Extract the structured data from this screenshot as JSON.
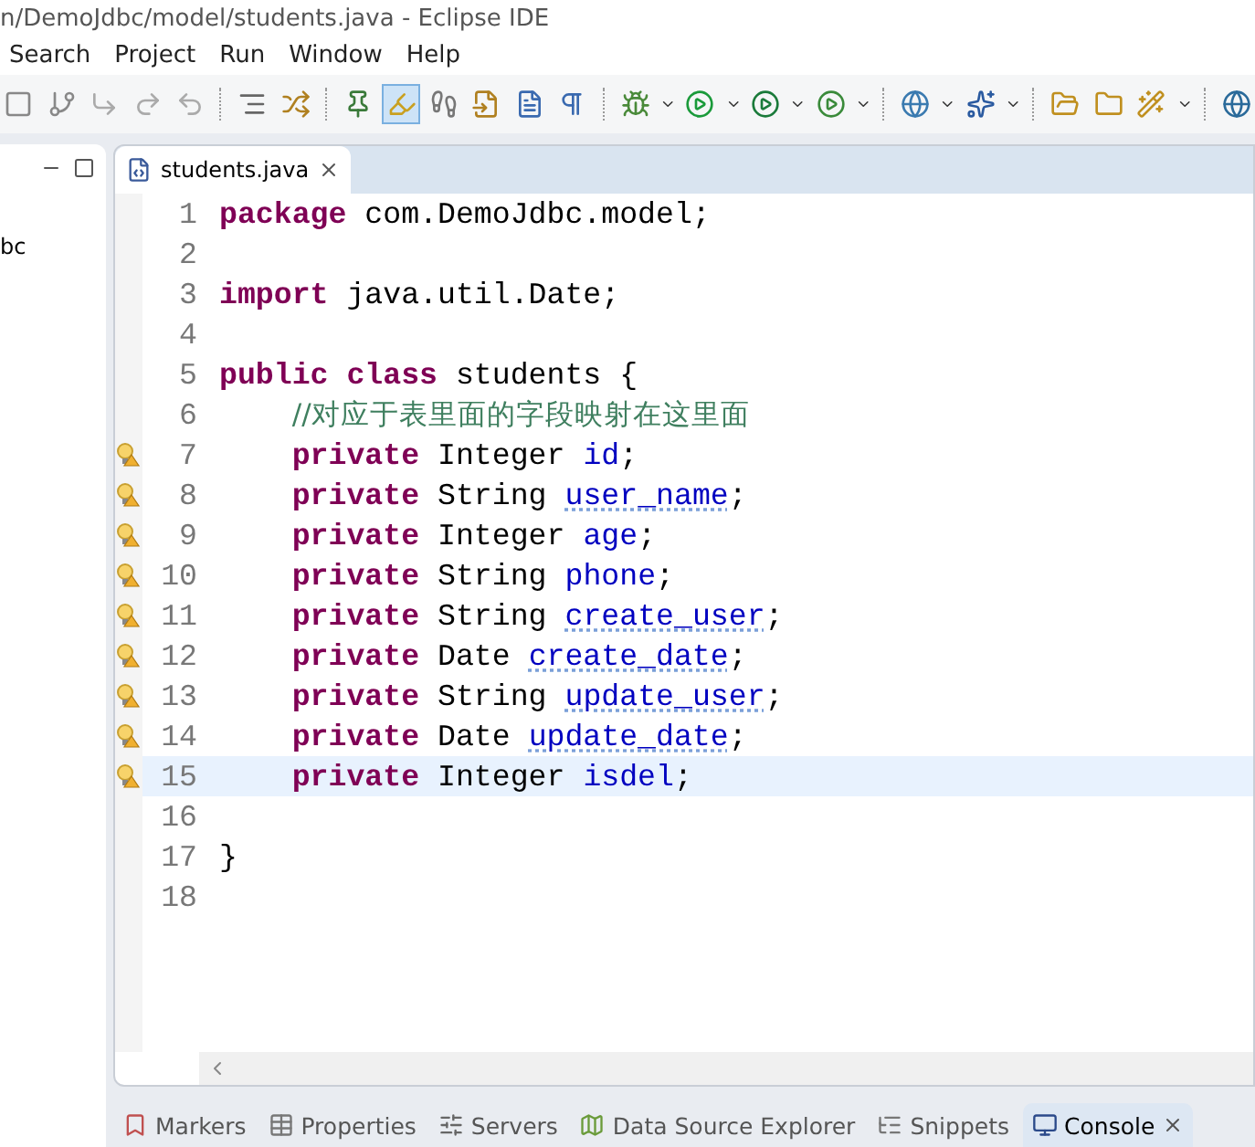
{
  "window": {
    "title": "n/DemoJdbc/model/students.java - Eclipse IDE"
  },
  "menu": [
    "Search",
    "Project",
    "Run",
    "Window",
    "Help"
  ],
  "toolbar": {
    "highlight_toggle": {
      "selected": true
    }
  },
  "left_panel": {
    "items": [
      "bc"
    ]
  },
  "editor": {
    "tab": {
      "label": "students.java",
      "selected": true
    },
    "lines": [
      {
        "number": "1",
        "warning": false,
        "selected": false,
        "tokens": [
          {
            "kind": "keyword",
            "text": "package"
          },
          {
            "kind": "plain",
            "text": " com.DemoJdbc.model;"
          }
        ]
      },
      {
        "number": "2",
        "warning": false,
        "selected": false
      },
      {
        "number": "3",
        "warning": false,
        "selected": false,
        "tokens": [
          {
            "kind": "keyword",
            "text": "import"
          },
          {
            "kind": "plain",
            "text": " java.util.Date;"
          }
        ]
      },
      {
        "number": "4",
        "warning": false,
        "selected": false
      },
      {
        "number": "5",
        "warning": false,
        "selected": false,
        "tokens": [
          {
            "kind": "keyword",
            "text": "public class"
          },
          {
            "kind": "plain",
            "text": " students {"
          }
        ]
      },
      {
        "number": "6",
        "warning": false,
        "selected": false,
        "tokens": [
          {
            "kind": "indent"
          },
          {
            "kind": "comment",
            "text": "//对应于表里面的字段映射在这里面"
          }
        ]
      },
      {
        "number": "7",
        "warning": true,
        "selected": false,
        "tokens": [
          {
            "kind": "indent"
          },
          {
            "kind": "keyword",
            "text": "private"
          },
          {
            "kind": "plain",
            "text": " Integer "
          },
          {
            "kind": "field",
            "text": "id"
          },
          {
            "kind": "plain",
            "text": ";"
          }
        ]
      },
      {
        "number": "8",
        "warning": true,
        "selected": false,
        "tokens": [
          {
            "kind": "indent"
          },
          {
            "kind": "keyword",
            "text": "private"
          },
          {
            "kind": "plain",
            "text": " String "
          },
          {
            "kind": "flagged",
            "text": "user_name"
          },
          {
            "kind": "plain",
            "text": ";"
          }
        ]
      },
      {
        "number": "9",
        "warning": true,
        "selected": false,
        "tokens": [
          {
            "kind": "indent"
          },
          {
            "kind": "keyword",
            "text": "private"
          },
          {
            "kind": "plain",
            "text": " Integer "
          },
          {
            "kind": "field",
            "text": "age"
          },
          {
            "kind": "plain",
            "text": ";"
          }
        ]
      },
      {
        "number": "10",
        "warning": true,
        "selected": false,
        "tokens": [
          {
            "kind": "indent"
          },
          {
            "kind": "keyword",
            "text": "private"
          },
          {
            "kind": "plain",
            "text": " String "
          },
          {
            "kind": "field",
            "text": "phone"
          },
          {
            "kind": "plain",
            "text": ";"
          }
        ]
      },
      {
        "number": "11",
        "warning": true,
        "selected": false,
        "tokens": [
          {
            "kind": "indent"
          },
          {
            "kind": "keyword",
            "text": "private"
          },
          {
            "kind": "plain",
            "text": " String "
          },
          {
            "kind": "flagged",
            "text": "create_user"
          },
          {
            "kind": "plain",
            "text": ";"
          }
        ]
      },
      {
        "number": "12",
        "warning": true,
        "selected": false,
        "tokens": [
          {
            "kind": "indent"
          },
          {
            "kind": "keyword",
            "text": "private"
          },
          {
            "kind": "plain",
            "text": " Date "
          },
          {
            "kind": "flagged",
            "text": "create_date"
          },
          {
            "kind": "plain",
            "text": ";"
          }
        ]
      },
      {
        "number": "13",
        "warning": true,
        "selected": false,
        "tokens": [
          {
            "kind": "indent"
          },
          {
            "kind": "keyword",
            "text": "private"
          },
          {
            "kind": "plain",
            "text": " String "
          },
          {
            "kind": "flagged",
            "text": "update_user"
          },
          {
            "kind": "plain",
            "text": ";"
          }
        ]
      },
      {
        "number": "14",
        "warning": true,
        "selected": false,
        "tokens": [
          {
            "kind": "indent"
          },
          {
            "kind": "keyword",
            "text": "private"
          },
          {
            "kind": "plain",
            "text": " Date "
          },
          {
            "kind": "flagged",
            "text": "update_date"
          },
          {
            "kind": "plain",
            "text": ";"
          }
        ]
      },
      {
        "number": "15",
        "warning": true,
        "selected": true,
        "tokens": [
          {
            "kind": "indent"
          },
          {
            "kind": "keyword",
            "text": "private"
          },
          {
            "kind": "plain",
            "text": " Integer "
          },
          {
            "kind": "field",
            "text": "isdel"
          },
          {
            "kind": "plain",
            "text": ";"
          }
        ]
      },
      {
        "number": "16",
        "warning": false,
        "selected": false
      },
      {
        "number": "17",
        "warning": false,
        "selected": false,
        "tokens": [
          {
            "kind": "plain",
            "text": "}"
          }
        ]
      },
      {
        "number": "18",
        "warning": false,
        "selected": false
      }
    ]
  },
  "bottom_tabs": [
    {
      "label": "Markers",
      "kind": "markers",
      "selected": false
    },
    {
      "label": "Properties",
      "kind": "properties",
      "selected": false
    },
    {
      "label": "Servers",
      "kind": "servers",
      "selected": false
    },
    {
      "label": "Data Source Explorer",
      "kind": "datasource",
      "selected": false
    },
    {
      "label": "Snippets",
      "kind": "snippets",
      "selected": false
    },
    {
      "label": "Console",
      "kind": "console",
      "selected": true
    }
  ]
}
